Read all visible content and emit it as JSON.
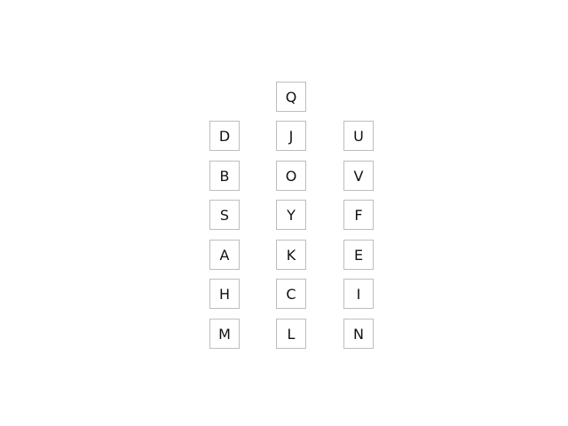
{
  "colors": {
    "background": "#ffffff",
    "tile_border": "#bdbdbd",
    "letter": "#111111"
  },
  "columns": [
    {
      "tiles": [
        "",
        "D",
        "B",
        "S",
        "A",
        "H",
        "M"
      ]
    },
    {
      "tiles": [
        "Q",
        "J",
        "O",
        "Y",
        "K",
        "C",
        "L"
      ]
    },
    {
      "tiles": [
        "",
        "U",
        "V",
        "F",
        "E",
        "I",
        "N"
      ]
    }
  ]
}
